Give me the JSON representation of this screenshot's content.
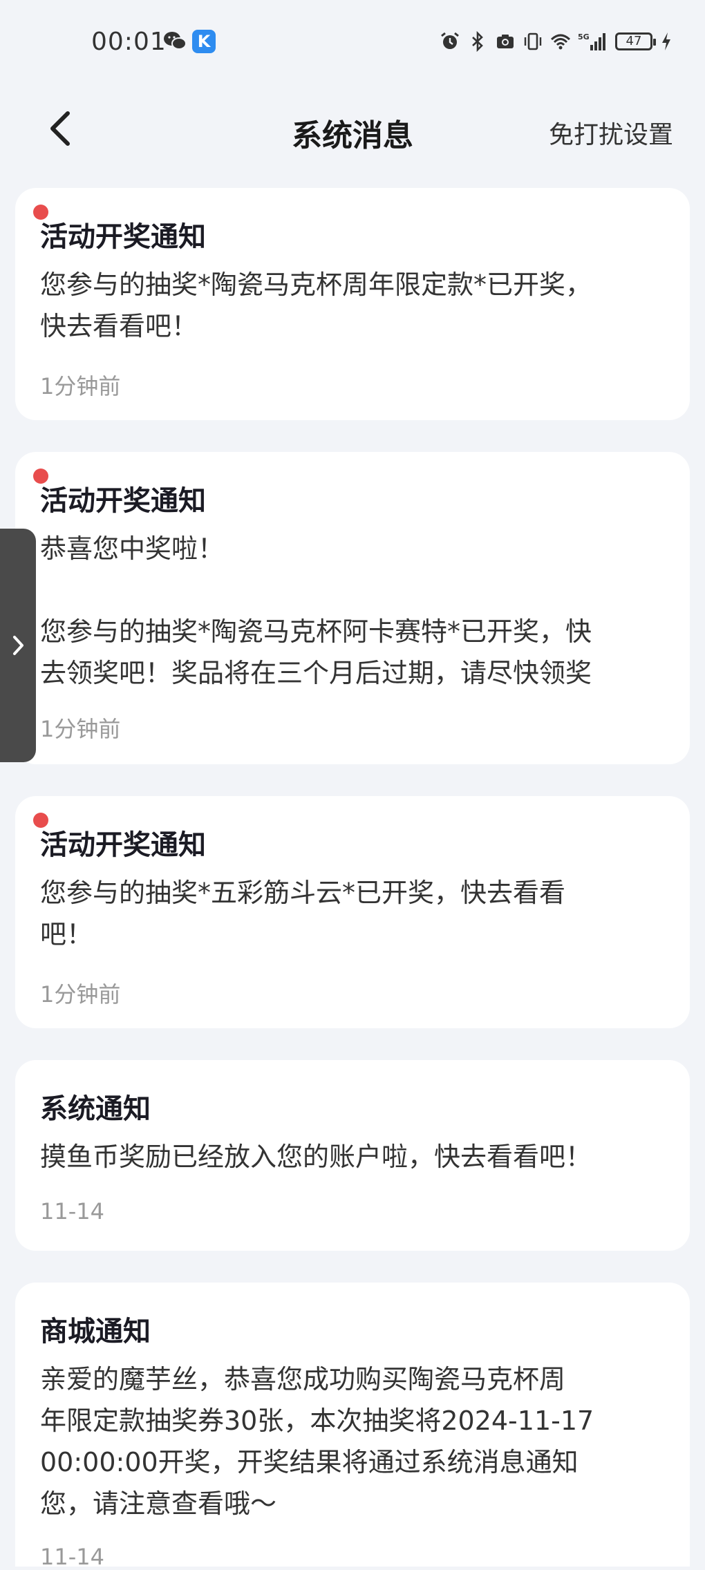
{
  "status_bar": {
    "time": "00:01",
    "app_badge": "K",
    "battery": "47"
  },
  "header": {
    "title": "系统消息",
    "dnd_label": "免打扰设置"
  },
  "messages": [
    {
      "title": "活动开奖通知",
      "body": "您参与的抽奖*陶瓷马克杯周年限定款*已开奖，\n快去看看吧！",
      "time": "1分钟前",
      "unread": true
    },
    {
      "title": "活动开奖通知",
      "body": "恭喜您中奖啦！\n\n您参与的抽奖*陶瓷马克杯阿卡赛特*已开奖，快\n去领奖吧！奖品将在三个月后过期，请尽快领奖",
      "time": "1分钟前",
      "unread": true
    },
    {
      "title": "活动开奖通知",
      "body": "您参与的抽奖*五彩筋斗云*已开奖，快去看看\n吧！",
      "time": "1分钟前",
      "unread": true
    },
    {
      "title": "系统通知",
      "body": "摸鱼币奖励已经放入您的账户啦，快去看看吧！",
      "time": "11-14",
      "unread": false
    },
    {
      "title": "商城通知",
      "body": "亲爱的魔芋丝，恭喜您成功购买陶瓷马克杯周\n年限定款抽奖券30张，本次抽奖将2024-11-17\n00:00:00开奖，开奖结果将通过系统消息通知\n您，请注意查看哦～",
      "time": "11-14",
      "unread": false
    }
  ],
  "colors": {
    "background": "#f2f4f8",
    "unread_dot": "#e84d4d",
    "time_text": "#999999"
  }
}
